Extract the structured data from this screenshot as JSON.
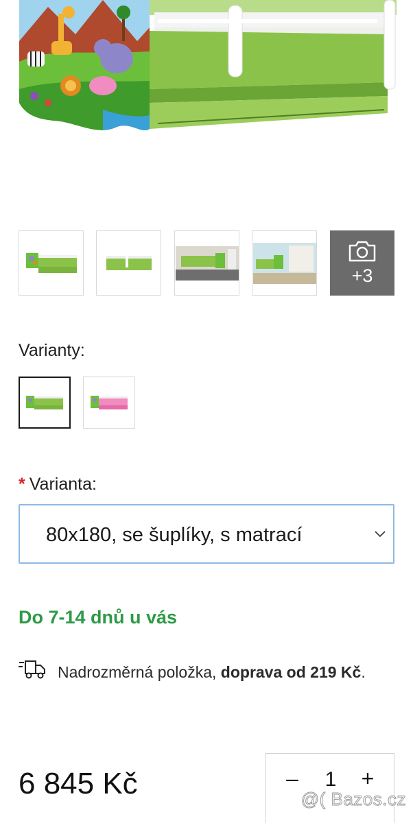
{
  "gallery": {
    "more_count": "+3",
    "thumbnails": [
      {
        "name": "bed-with-drawer"
      },
      {
        "name": "bed-green-side"
      },
      {
        "name": "bed-room-1"
      },
      {
        "name": "bed-room-2"
      }
    ]
  },
  "variants": {
    "label": "Varianty:",
    "options": [
      {
        "color": "green",
        "selected": true
      },
      {
        "color": "pink",
        "selected": false
      }
    ]
  },
  "variant_select": {
    "required_mark": "*",
    "label": "Varianta:",
    "value": "80x180, se šuplíky, s matrací"
  },
  "delivery": {
    "text": "Do 7-14 dnů u vás",
    "color": "#2e9a48"
  },
  "shipping": {
    "text_prefix": "Nadrozměrná položka, ",
    "text_bold": "doprava od 219 Kč",
    "text_suffix": "."
  },
  "price": {
    "amount": "6 845 Kč"
  },
  "quantity": {
    "minus": "–",
    "value": "1",
    "plus": "+"
  },
  "watermark": "@( Bazos.cz",
  "colors": {
    "accent_green": "#2e9a48",
    "select_border": "#8fb8e6",
    "required": "#d8232a",
    "bed_green": "#8bc34a"
  }
}
